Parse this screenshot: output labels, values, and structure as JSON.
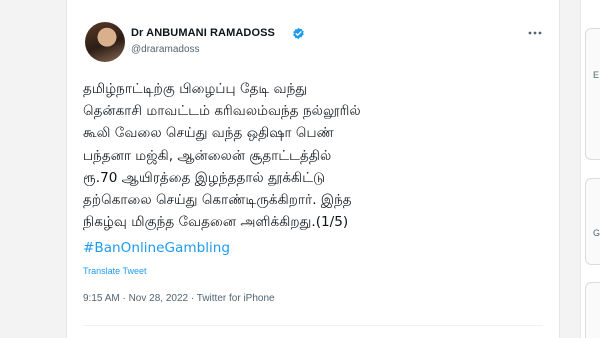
{
  "author": {
    "display_name": "Dr ANBUMANI RAMADOSS",
    "handle": "@draramadoss",
    "verified_icon": "verified-badge-icon",
    "avatar_icon": "profile-photo"
  },
  "tweet": {
    "text": "தமிழ்நாட்டிற்கு பிழைப்பு தேடி வந்து\nதென்காசி மாவட்டம் கரிவலம்வந்த நல்லூரில்\nகூலி வேலை செய்து வந்த ஒதிஷா பெண்\nபந்தனா மஜ்கி, ஆன்லைன் சூதாட்டத்தில்\nரூ.70 ஆயிரத்தை இழந்ததால் தூக்கிட்டு\nதற்கொலை செய்து கொண்டிருக்கிறார். இந்த\nநிகழ்வு மிகுந்த வேதனை அளிக்கிறது.(1/5)",
    "hashtag": "#BanOnlineGambling",
    "translate_label": "Translate Tweet",
    "meta": "9:15 AM · Nov 28, 2022 · Twitter for iPhone"
  },
  "right_panel": {
    "label_1": "E",
    "label_2": "G"
  },
  "colors": {
    "link": "#1d9bf0",
    "secondary_text": "#536471",
    "verified": "#1d9bf0"
  }
}
